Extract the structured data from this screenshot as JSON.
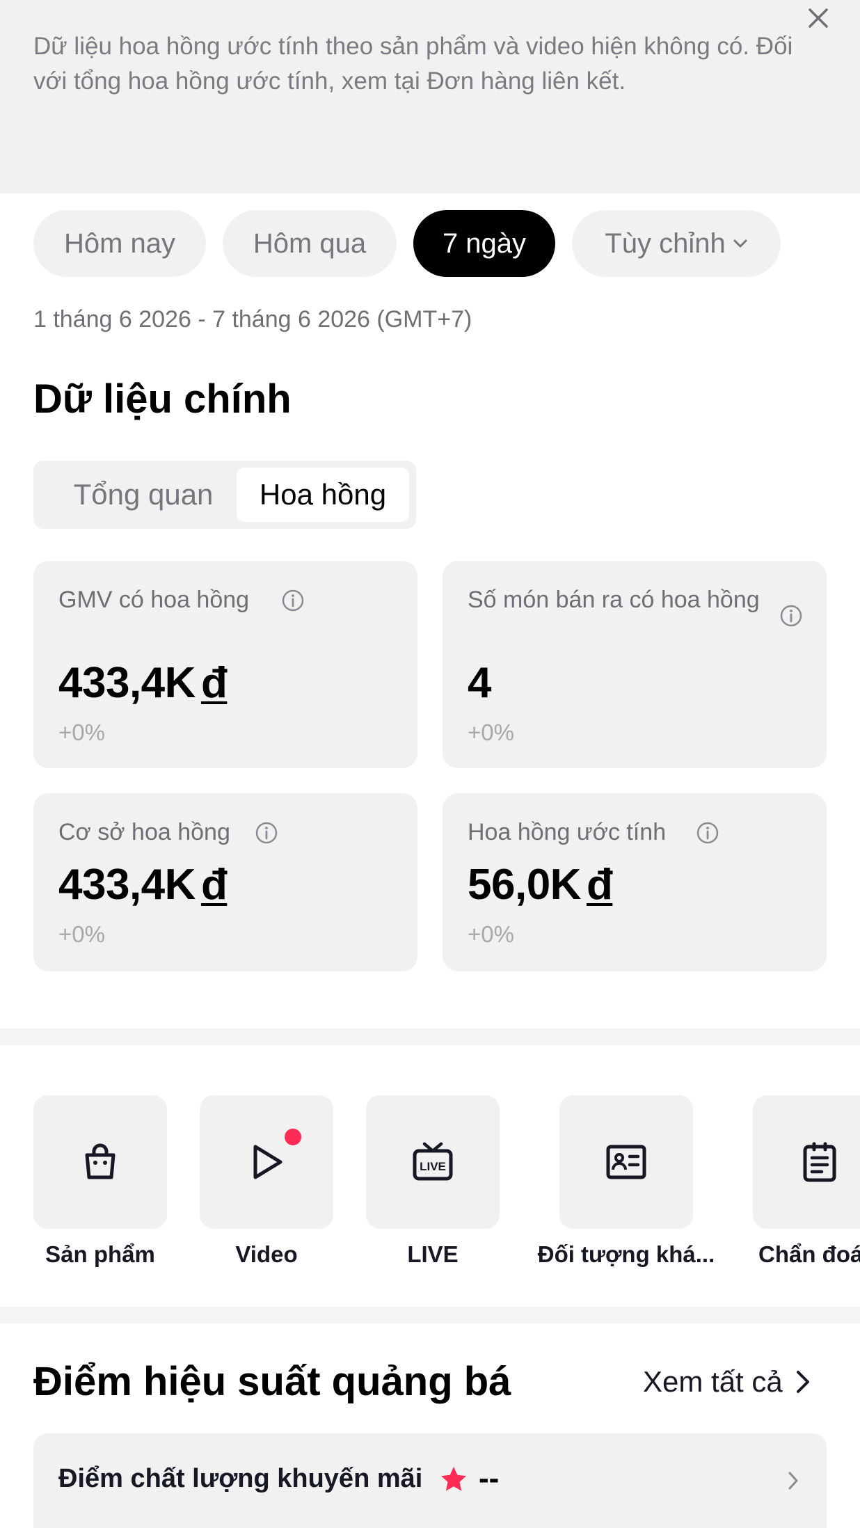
{
  "banner": {
    "text": "Dữ liệu hoa hồng ước tính theo sản phẩm và video hiện không có. Đối với tổng hoa hồng ước tính, xem tại Đơn hàng liên kết.",
    "close_icon": "close-icon"
  },
  "date_tabs": [
    {
      "label": "Hôm nay",
      "active": false
    },
    {
      "label": "Hôm qua",
      "active": false
    },
    {
      "label": "7 ngày",
      "active": true
    },
    {
      "label": "Tùy chỉnh",
      "active": false,
      "icon": "chevron-down-icon"
    }
  ],
  "date_range": "1 tháng 6 2026 - 7 tháng 6 2026 (GMT+7)",
  "main_title": "Dữ liệu chính",
  "segment": {
    "items": [
      "Tổng quan",
      "Hoa hồng"
    ],
    "selected": "Hoa hồng"
  },
  "metrics": [
    {
      "label": "GMV có hoa hồng",
      "value": "433,4K",
      "currency": "đ",
      "change": "+0%",
      "icon": "info-icon"
    },
    {
      "label": "Số món bán ra có hoa hồng",
      "value": "4",
      "currency": "",
      "change": "+0%",
      "icon": "info-icon"
    },
    {
      "label": "Cơ sở hoa hồng",
      "value": "433,4K",
      "currency": "đ",
      "change": "+0%",
      "icon": "info-icon"
    },
    {
      "label": "Hoa hồng ước tính",
      "value": "56,0K",
      "currency": "đ",
      "change": "+0%",
      "icon": "info-icon"
    }
  ],
  "quick_access": [
    {
      "label": "Sản phẩm",
      "icon": "shopping-bag-icon"
    },
    {
      "label": "Video",
      "icon": "play-icon",
      "badge": true
    },
    {
      "label": "LIVE",
      "icon": "live-tv-icon"
    },
    {
      "label": "Đối tượng khá...",
      "icon": "id-card-icon"
    },
    {
      "label": "Chẩn đoá",
      "icon": "clipboard-icon"
    }
  ],
  "performance": {
    "title": "Điểm hiệu suất quảng bá",
    "see_all": "Xem tất cả",
    "score_label": "Điểm chất lượng khuyến mãi",
    "score_value": "--"
  },
  "colors": {
    "accent": "#fe2c55",
    "card_bg": "#f1f1f2",
    "active_tab_bg": "#000000"
  }
}
